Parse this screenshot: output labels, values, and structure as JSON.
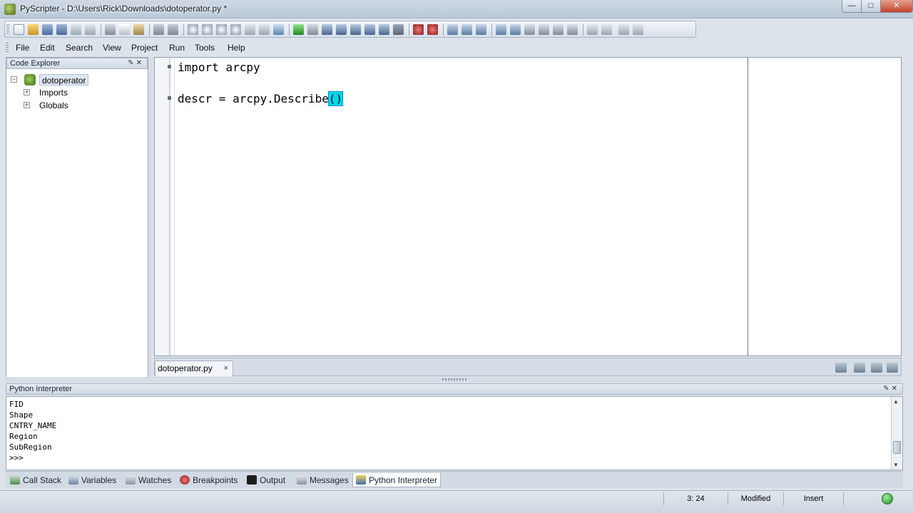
{
  "window": {
    "title": "PyScripter - D:\\Users\\Rick\\Downloads\\dotoperator.py *"
  },
  "menu": [
    "File",
    "Edit",
    "Search",
    "View",
    "Project",
    "Run",
    "Tools",
    "Help"
  ],
  "code_explorer": {
    "title": "Code Explorer",
    "module": "dotoperator",
    "children": [
      "Imports",
      "Globals"
    ]
  },
  "editor": {
    "lines": [
      {
        "text": "import arcpy"
      },
      {
        "text": ""
      },
      {
        "pre": "descr = arcpy.Describe",
        "bracket": "()"
      }
    ],
    "tab_label": "dotoperator.py",
    "tab_close": "×"
  },
  "interpreter": {
    "title": "Python Interpreter",
    "output": [
      "FID",
      "Shape",
      "CNTRY_NAME",
      "Region",
      "SubRegion",
      ">>>"
    ]
  },
  "bottom_tabs": [
    "Call Stack",
    "Variables",
    "Watches",
    "Breakpoints",
    "Output",
    "Messages",
    "Python Interpreter"
  ],
  "status": {
    "position": "3: 24",
    "modified": "Modified",
    "mode": "Insert"
  }
}
